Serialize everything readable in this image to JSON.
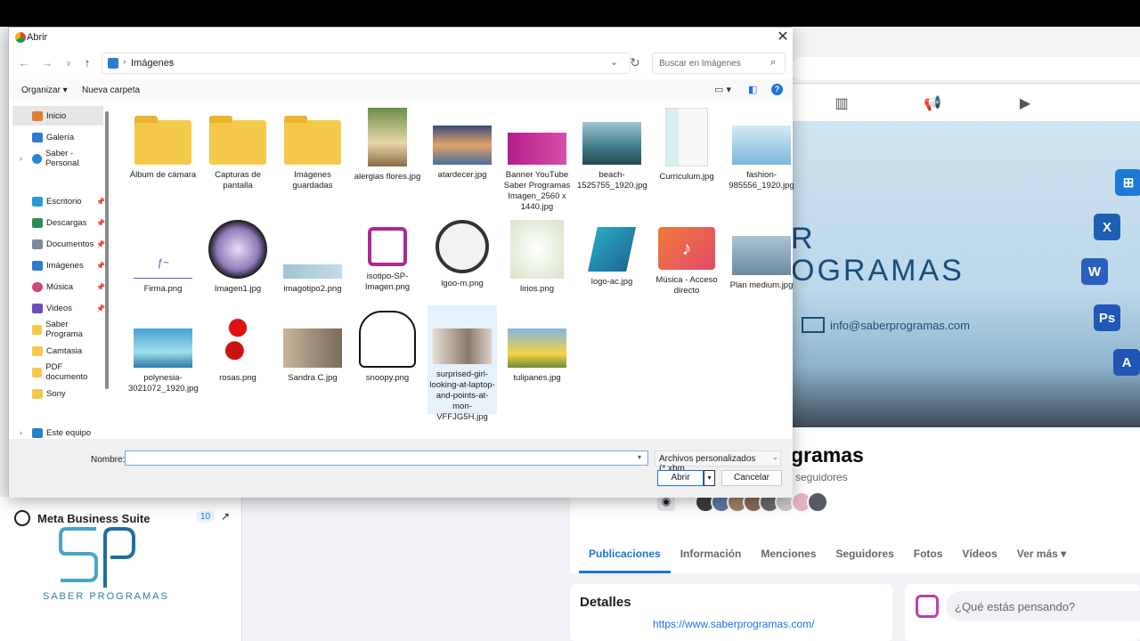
{
  "dialog": {
    "title": "Abrir",
    "breadcrumb": "Imágenes",
    "search_placeholder": "Buscar en Imágenes",
    "toolbar": {
      "organize": "Organizar",
      "new_folder": "Nueva carpeta"
    },
    "sidebar": [
      {
        "label": "Inicio",
        "selected": true
      },
      {
        "label": "Galería"
      },
      {
        "label": "Saber - Personal"
      },
      {
        "label": "Escritorio"
      },
      {
        "label": "Descargas"
      },
      {
        "label": "Documentos"
      },
      {
        "label": "Imágenes"
      },
      {
        "label": "Música"
      },
      {
        "label": "Videos"
      },
      {
        "label": "Saber Programa"
      },
      {
        "label": "Camtasia"
      },
      {
        "label": "PDF documento"
      },
      {
        "label": "Sony"
      },
      {
        "label": "Este equipo"
      }
    ],
    "files": [
      {
        "name": "Álbum de cámara",
        "icon": "folder"
      },
      {
        "name": "Capturas de pantalla",
        "icon": "folder"
      },
      {
        "name": "Imágenes guardadas",
        "icon": "folder"
      },
      {
        "name": "alergias flores.jpg",
        "icon": "image"
      },
      {
        "name": "atardecer.jpg",
        "icon": "image"
      },
      {
        "name": "Banner YouTube Saber Programas Imagen_2560 x 1440.jpg",
        "icon": "image"
      },
      {
        "name": "beach-1525755_1920.jpg",
        "icon": "image"
      },
      {
        "name": "Curriculum.jpg",
        "icon": "image"
      },
      {
        "name": "fashion-985556_1920.jpg",
        "icon": "image"
      },
      {
        "name": "Firma.png",
        "icon": "image"
      },
      {
        "name": "Imagen1.jpg",
        "icon": "image"
      },
      {
        "name": "imagotipo2.png",
        "icon": "image"
      },
      {
        "name": "isotipo-SP-Imagen.png",
        "icon": "image"
      },
      {
        "name": "lgoo-m.png",
        "icon": "image"
      },
      {
        "name": "lirios.png",
        "icon": "image"
      },
      {
        "name": "logo-ac.jpg",
        "icon": "image"
      },
      {
        "name": "Música - Acceso directo",
        "icon": "music-folder"
      },
      {
        "name": "Plan medium.jpg",
        "icon": "image"
      },
      {
        "name": "polynesia-3021072_1920.jpg",
        "icon": "image"
      },
      {
        "name": "rosas.png",
        "icon": "image"
      },
      {
        "name": "Sandra C.jpg",
        "icon": "image"
      },
      {
        "name": "snoopy.png",
        "icon": "image"
      },
      {
        "name": "surprised-girl-looking-at-laptop-and-points-at-mon-VFFJG5H.jpg",
        "icon": "image",
        "selected": true
      },
      {
        "name": "tulipanes.jpg",
        "icon": "image"
      }
    ],
    "name_label": "Nombre:",
    "name_value": "",
    "filter": "Archivos personalizados (*.xbm",
    "open_btn": "Abrir",
    "cancel_btn": "Cancelar"
  },
  "background": {
    "cover_line1": "R",
    "cover_line2": "OGRAMAS",
    "cover_email": "info@saberprogramas.com",
    "page_name": "gramas",
    "followers": "seguidores",
    "tabs": [
      "Publicaciones",
      "Información",
      "Menciones",
      "Seguidores",
      "Fotos",
      "Vídeos",
      "Ver más"
    ],
    "meta_suite": "Meta Business Suite",
    "meta_badge": "10",
    "logo_text": "SABER PROGRAMAS",
    "details_title": "Detalles",
    "details_link": "https://www.saberprogramas.com/",
    "composer_placeholder": "¿Qué estás pensando?",
    "app_icons": [
      "Windows",
      "Word-X",
      "Word",
      "Ps",
      "A"
    ]
  }
}
